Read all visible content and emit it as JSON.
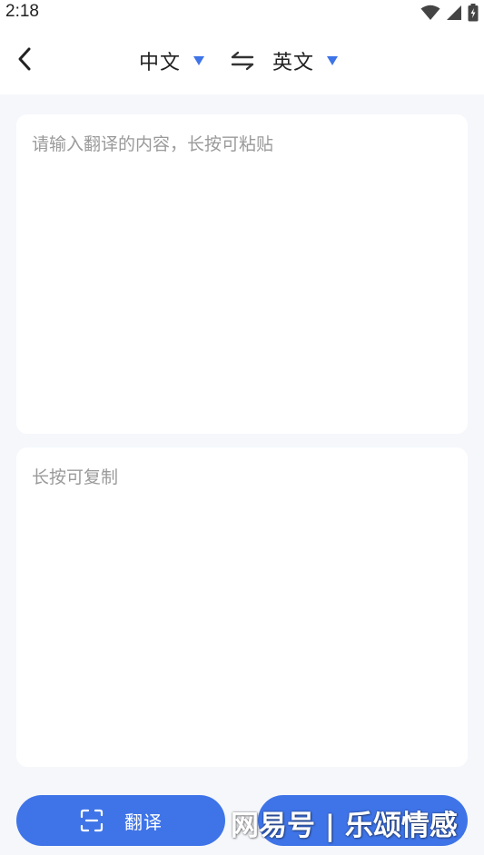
{
  "status_bar": {
    "time": "2:18",
    "icons": [
      "wifi-icon",
      "cell-signal-icon",
      "battery-icon"
    ]
  },
  "header": {
    "back_icon": "chevron-left-icon",
    "source_language": "中文",
    "target_language": "英文",
    "swap_icon": "swap-arrows-icon"
  },
  "input_card": {
    "value": "",
    "placeholder": "请输入翻译的内容，长按可粘贴"
  },
  "output_card": {
    "text": "长按可复制"
  },
  "actions": {
    "translate_label": "翻译",
    "translate_icon": "scan-translate-icon"
  },
  "watermark": {
    "text": "网易号 | 乐颂情感"
  },
  "colors": {
    "accent": "#3f74e8",
    "background": "#f5f7fb",
    "card": "#ffffff",
    "placeholder": "#9a9a9a"
  }
}
